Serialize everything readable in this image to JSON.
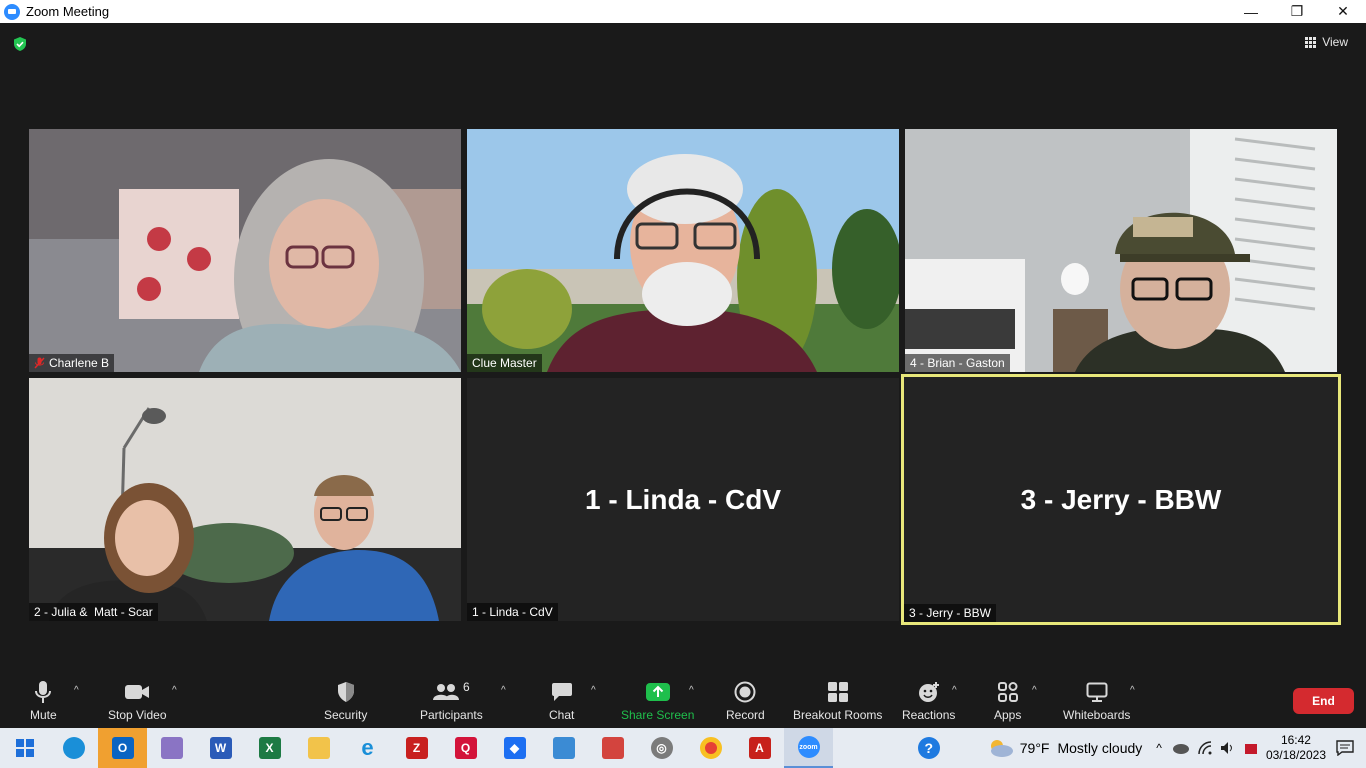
{
  "window": {
    "title": "Zoom Meeting",
    "minimize": "—",
    "maximize": "❐",
    "close": "✕"
  },
  "meeting": {
    "view_label": "View",
    "tiles": [
      {
        "name": "Charlene B",
        "muted": true
      },
      {
        "name": "Clue Master"
      },
      {
        "name": "4 - Brian - Gaston"
      },
      {
        "name": "2 - Julia &  Matt - Scar"
      },
      {
        "name": "1 - Linda - CdV",
        "center_name": "1 - Linda - CdV"
      },
      {
        "name": "3 - Jerry - BBW",
        "center_name": "3 - Jerry - BBW",
        "active_speaker": true
      }
    ]
  },
  "toolbar": {
    "mute": "Mute",
    "stop_video": "Stop Video",
    "security": "Security",
    "participants": "Participants",
    "participants_count": "6",
    "chat": "Chat",
    "share_screen": "Share Screen",
    "record": "Record",
    "breakout_rooms": "Breakout Rooms",
    "reactions": "Reactions",
    "apps": "Apps",
    "whiteboards": "Whiteboards",
    "end": "End",
    "caret": "^"
  },
  "taskbar": {
    "weather_temp": "79°F",
    "weather_desc": "Mostly cloudy",
    "time": "16:42",
    "date": "03/18/2023",
    "tray_caret": "^"
  },
  "colors": {
    "end_button": "#d42a2f",
    "share_green": "#1fbf4c",
    "active_border": "#e8e77a",
    "shield_green": "#23c552"
  }
}
